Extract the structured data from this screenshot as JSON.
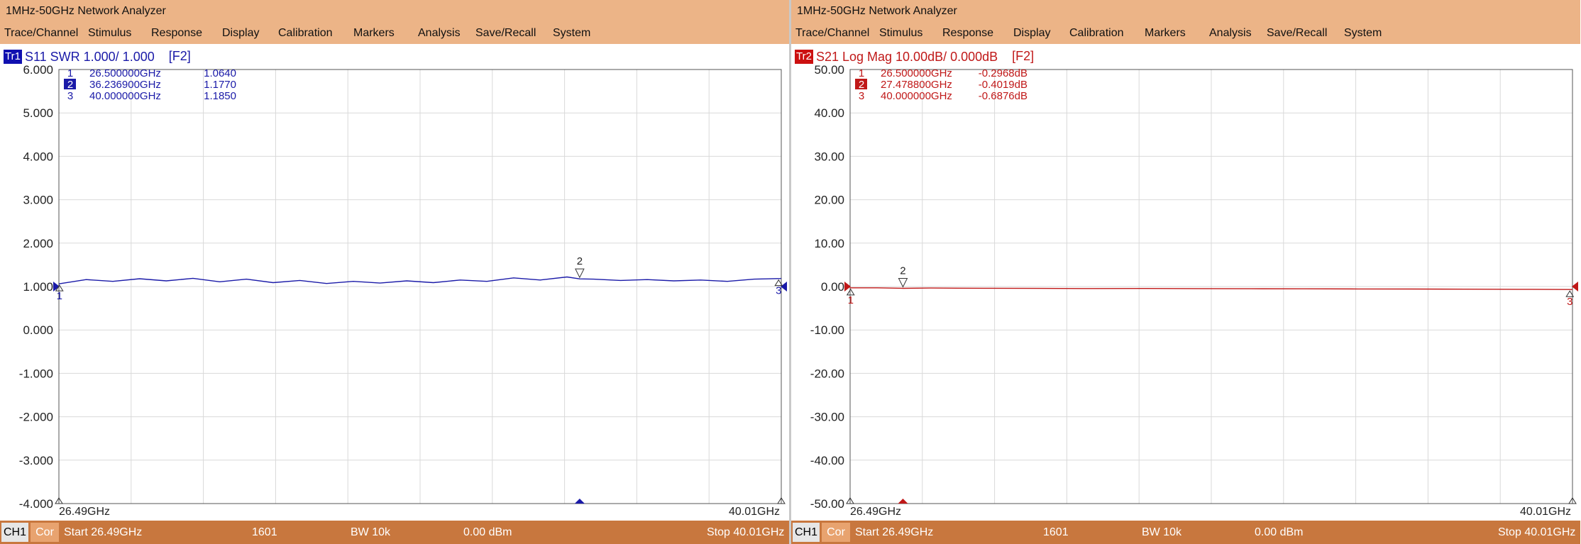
{
  "windows": [
    {
      "id": "left",
      "title": "1MHz-50GHz Network Analyzer",
      "menu": [
        "Trace/Channel",
        "Stimulus",
        "Response",
        "Display",
        "Calibration",
        "Markers",
        "Analysis",
        "Save/Recall",
        "System"
      ],
      "trace": {
        "badge": "Tr1",
        "label": "S11  SWR 1.000/ 1.000",
        "tag": "[F2]",
        "color": "#1a1aa8",
        "badge_bg": "#1010b0"
      },
      "y_ticks": [
        "6.000",
        "5.000",
        "4.000",
        "3.000",
        "2.000",
        "1.000",
        "0.000",
        "-1.000",
        "-2.000",
        "-3.000",
        "-4.000"
      ],
      "x_start_label": "26.49GHz",
      "x_stop_label": "40.01GHz",
      "markers": [
        {
          "num": "1",
          "freq": "26.500000GHz",
          "value": "1.0640",
          "active": false
        },
        {
          "num": "2",
          "freq": "36.236900GHz",
          "value": "1.1770",
          "active": true
        },
        {
          "num": "3",
          "freq": "40.000000GHz",
          "value": "1.1850",
          "active": false
        }
      ],
      "status": {
        "channel": "CH1",
        "cor": "Cor",
        "start": "Start 26.49GHz",
        "points": "1601",
        "bw": "BW 10k",
        "power": "0.00 dBm",
        "stop": "Stop 40.01GHz"
      }
    },
    {
      "id": "right",
      "title": "1MHz-50GHz Network Analyzer",
      "menu": [
        "Trace/Channel",
        "Stimulus",
        "Response",
        "Display",
        "Calibration",
        "Markers",
        "Analysis",
        "Save/Recall",
        "System"
      ],
      "trace": {
        "badge": "Tr2",
        "label": "S21  Log Mag 10.00dB/ 0.000dB",
        "tag": "[F2]",
        "color": "#c01818",
        "badge_bg": "#cc1010"
      },
      "y_ticks": [
        "50.00",
        "40.00",
        "30.00",
        "20.00",
        "10.00",
        "0.00",
        "-10.00",
        "-20.00",
        "-30.00",
        "-40.00",
        "-50.00"
      ],
      "x_start_label": "26.49GHz",
      "x_stop_label": "40.01GHz",
      "markers": [
        {
          "num": "1",
          "freq": "26.500000GHz",
          "value": "-0.2968dB",
          "active": false
        },
        {
          "num": "2",
          "freq": "27.478800GHz",
          "value": "-0.4019dB",
          "active": true
        },
        {
          "num": "3",
          "freq": "40.000000GHz",
          "value": "-0.6876dB",
          "active": false
        }
      ],
      "status": {
        "channel": "CH1",
        "cor": "Cor",
        "start": "Start 26.49GHz",
        "points": "1601",
        "bw": "BW 10k",
        "power": "0.00 dBm",
        "stop": "Stop 40.01GHz"
      }
    }
  ],
  "chart_data": [
    {
      "type": "line",
      "title": "S11  SWR 1.000/ 1.000",
      "xlabel": "",
      "ylabel": "",
      "xlim": [
        26.49,
        40.01
      ],
      "ylim": [
        -4.0,
        6.0
      ],
      "grid": true,
      "series": [
        {
          "name": "S11",
          "x": [
            26.49,
            26.5,
            27.0,
            27.5,
            28.0,
            28.5,
            29.0,
            29.5,
            30.0,
            30.5,
            31.0,
            31.5,
            32.0,
            32.5,
            33.0,
            33.5,
            34.0,
            34.5,
            35.0,
            35.5,
            36.0,
            36.2369,
            36.5,
            37.0,
            37.5,
            38.0,
            38.5,
            39.0,
            39.5,
            40.0,
            40.01
          ],
          "y": [
            1.06,
            1.064,
            1.16,
            1.12,
            1.18,
            1.13,
            1.19,
            1.11,
            1.17,
            1.09,
            1.14,
            1.07,
            1.12,
            1.08,
            1.13,
            1.09,
            1.15,
            1.12,
            1.2,
            1.15,
            1.22,
            1.177,
            1.17,
            1.14,
            1.16,
            1.13,
            1.15,
            1.12,
            1.17,
            1.185,
            1.19
          ]
        }
      ],
      "markers": [
        {
          "label": "1",
          "x": 26.5,
          "y": 1.064
        },
        {
          "label": "2",
          "x": 36.2369,
          "y": 1.177
        },
        {
          "label": "3",
          "x": 40.0,
          "y": 1.185
        }
      ]
    },
    {
      "type": "line",
      "title": "S21  Log Mag 10.00dB/ 0.000dB",
      "xlabel": "",
      "ylabel": "",
      "xlim": [
        26.49,
        40.01
      ],
      "ylim": [
        -50.0,
        50.0
      ],
      "grid": true,
      "series": [
        {
          "name": "S21",
          "x": [
            26.49,
            26.5,
            27.0,
            27.4788,
            28.0,
            28.5,
            29.0,
            30.0,
            31.0,
            32.0,
            33.0,
            34.0,
            35.0,
            36.0,
            37.0,
            38.0,
            39.0,
            40.0,
            40.01
          ],
          "y": [
            -0.29,
            -0.2968,
            -0.3,
            -0.4019,
            -0.35,
            -0.38,
            -0.4,
            -0.42,
            -0.45,
            -0.44,
            -0.48,
            -0.5,
            -0.52,
            -0.55,
            -0.58,
            -0.6,
            -0.64,
            -0.6876,
            -0.69
          ]
        }
      ],
      "markers": [
        {
          "label": "1",
          "x": 26.5,
          "y": -0.2968
        },
        {
          "label": "2",
          "x": 27.4788,
          "y": -0.4019
        },
        {
          "label": "3",
          "x": 40.0,
          "y": -0.6876
        }
      ]
    }
  ]
}
